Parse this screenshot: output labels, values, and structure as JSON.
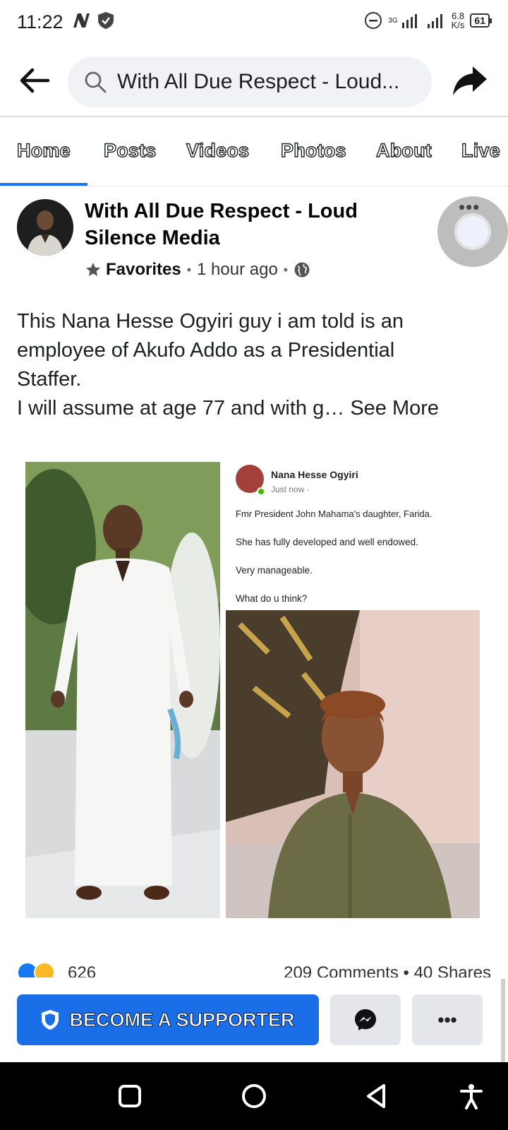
{
  "status_bar": {
    "time": "11:22",
    "net_speed_value": "6.8",
    "net_speed_unit": "K/s",
    "battery": "61",
    "signal_label": "3G"
  },
  "header": {
    "search_text": "With All Due Respect - Loud..."
  },
  "tabs": [
    {
      "label": "Home",
      "active": true
    },
    {
      "label": "Posts"
    },
    {
      "label": "Videos"
    },
    {
      "label": "Photos"
    },
    {
      "label": "About"
    },
    {
      "label": "Live"
    }
  ],
  "post": {
    "page_name": "With All Due Respect - Loud Silence Media",
    "badge": "Favorites",
    "time": "1 hour ago",
    "text_lines": [
      "This Nana Hesse Ogyiri guy i am told is an",
      "employee of Akufo Addo as a Presidential",
      "Staffer.",
      "I will assume at age 77 and with g… "
    ],
    "see_more": "See More",
    "embedded_post": {
      "author": "Nana Hesse Ogyiri",
      "time": "Just now ·",
      "lines": [
        "Fmr President John Mahama's daughter, Farida.",
        "She has fully developed and well endowed.",
        "Very manageable.",
        "What do u think?"
      ]
    },
    "reaction_count": "626",
    "stats": "209 Comments • 40 Shares"
  },
  "actions": {
    "support_label": "BECOME A SUPPORTER",
    "more_label": "•••"
  },
  "colors": {
    "accent": "#1877f2",
    "support_button": "#1a6ee8",
    "secondary_button": "#e4e6eb"
  }
}
